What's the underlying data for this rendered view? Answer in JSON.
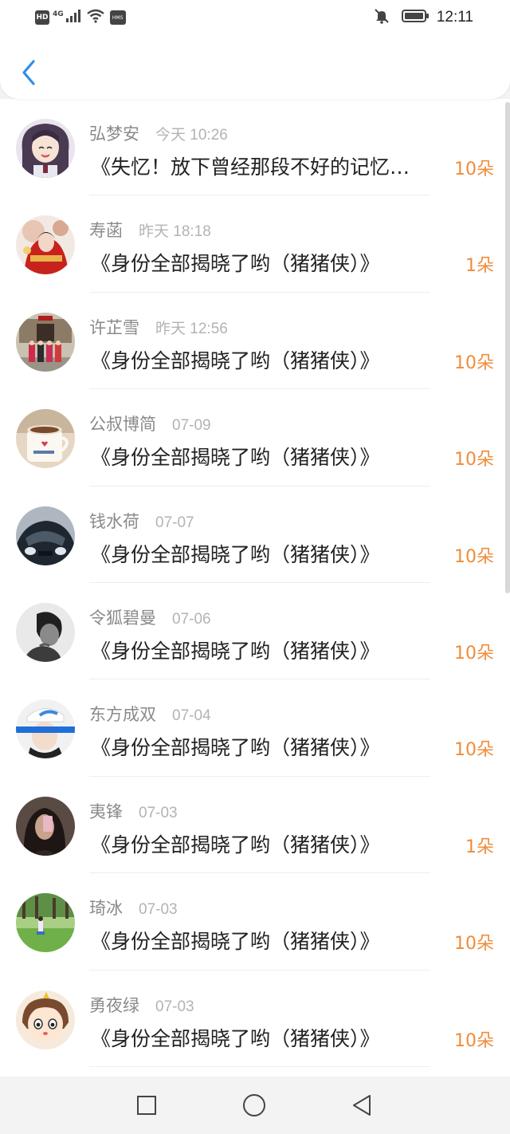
{
  "status_bar": {
    "hd_label": "HD",
    "network_label": "4G",
    "hms_label": "HMS",
    "time": "12:11"
  },
  "icons": {
    "back": "back-chevron-icon",
    "mute": "bell-muted-icon",
    "battery": "battery-icon",
    "signal": "signal-icon",
    "wifi": "wifi-icon"
  },
  "colors": {
    "back_arrow": "#2f8fe6",
    "name": "#8a8a8a",
    "time": "#b3b3b3",
    "title": "#222222",
    "count": "#f08c3a"
  },
  "records": [
    {
      "name": "弘梦安",
      "time": "今天 10:26",
      "title": "《失忆！放下曾经那段不好的记忆…",
      "count": "10朵",
      "avatar": "anime-girl"
    },
    {
      "name": "寿菡",
      "time": "昨天 18:18",
      "title": "《身份全部揭晓了哟（猪猪侠）》",
      "count": "1朵",
      "avatar": "red-costume"
    },
    {
      "name": "许芷雪",
      "time": "昨天 12:56",
      "title": "《身份全部揭晓了哟（猪猪侠）》",
      "count": "10朵",
      "avatar": "group-photo"
    },
    {
      "name": "公叔博简",
      "time": "07-09",
      "title": "《身份全部揭晓了哟（猪猪侠）》",
      "count": "10朵",
      "avatar": "coffee-cup"
    },
    {
      "name": "钱水荷",
      "time": "07-07",
      "title": "《身份全部揭晓了哟（猪猪侠）》",
      "count": "10朵",
      "avatar": "car"
    },
    {
      "name": "令狐碧曼",
      "time": "07-06",
      "title": "《身份全部揭晓了哟（猪猪侠）》",
      "count": "10朵",
      "avatar": "bw-portrait"
    },
    {
      "name": "东方成双",
      "time": "07-04",
      "title": "《身份全部揭晓了哟（猪猪侠）》",
      "count": "10朵",
      "avatar": "cap-portrait"
    },
    {
      "name": "夷锋",
      "time": "07-03",
      "title": "《身份全部揭晓了哟（猪猪侠）》",
      "count": "1朵",
      "avatar": "mirror-selfie"
    },
    {
      "name": "琦冰",
      "time": "07-03",
      "title": "《身份全部揭晓了哟（猪猪侠）》",
      "count": "10朵",
      "avatar": "park"
    },
    {
      "name": "勇夜绿",
      "time": "07-03",
      "title": "《身份全部揭晓了哟（猪猪侠）》",
      "count": "10朵",
      "avatar": "cartoon-kid"
    }
  ],
  "nav": {
    "recents": "square-icon",
    "home": "circle-icon",
    "back": "triangle-back-icon"
  }
}
